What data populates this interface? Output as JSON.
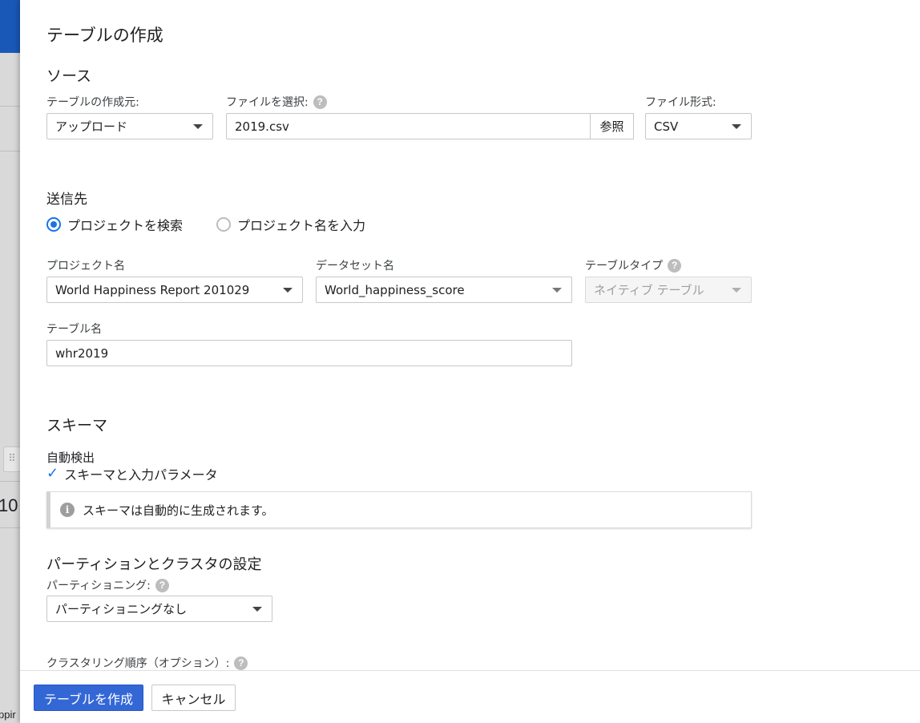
{
  "background": {
    "text_partial": "10",
    "text_bottom": "ppir"
  },
  "dialog": {
    "title": "テーブルの作成"
  },
  "source": {
    "section_title": "ソース",
    "create_from_label": "テーブルの作成元:",
    "create_from_value": "アップロード",
    "file_label": "ファイルを選択:",
    "file_value": "2019.csv",
    "browse_label": "参照",
    "format_label": "ファイル形式:",
    "format_value": "CSV"
  },
  "destination": {
    "section_title": "送信先",
    "radio_search": "プロジェクトを検索",
    "radio_enter": "プロジェクト名を入力",
    "project_label": "プロジェクト名",
    "project_value": "World Happiness Report 201029",
    "dataset_label": "データセット名",
    "dataset_value": "World_happiness_score",
    "table_type_label": "テーブルタイプ",
    "table_type_value": "ネイティブ テーブル",
    "table_name_label": "テーブル名",
    "table_name_value": "whr2019"
  },
  "schema": {
    "section_title": "スキーマ",
    "auto_detect_label": "自動検出",
    "auto_detect_checkbox": "スキーマと入力パラメータ",
    "info_text": "スキーマは自動的に生成されます。"
  },
  "partition": {
    "section_title": "パーティションとクラスタの設定",
    "partitioning_label": "パーティショニング:",
    "partitioning_value": "パーティショニングなし",
    "clustering_label": "クラスタリング順序（オプション）:"
  },
  "footer": {
    "create_label": "テーブルを作成",
    "cancel_label": "キャンセル"
  },
  "colors": {
    "primary": "#3367d6",
    "accent": "#1a73e8",
    "topbar": "#1a58b8"
  }
}
